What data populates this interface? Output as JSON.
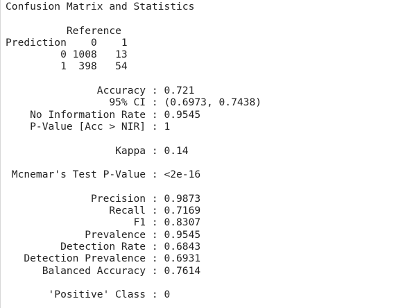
{
  "console": {
    "lines": [
      "Confusion Matrix and Statistics",
      "",
      "          Reference",
      "Prediction    0    1",
      "         0 1008   13",
      "         1  398   54",
      "",
      "               Accuracy : 0.721",
      "                 95% CI : (0.6973, 0.7438)",
      "    No Information Rate : 0.9545",
      "    P-Value [Acc > NIR] : 1",
      "",
      "                  Kappa : 0.14",
      "",
      " Mcnemar's Test P-Value : <2e-16",
      "",
      "              Precision : 0.9873",
      "                 Recall : 0.7169",
      "                     F1 : 0.8307",
      "             Prevalence : 0.9545",
      "         Detection Rate : 0.6843",
      "   Detection Prevalence : 0.6931",
      "      Balanced Accuracy : 0.7614",
      "",
      "       'Positive' Class : 0"
    ]
  }
}
